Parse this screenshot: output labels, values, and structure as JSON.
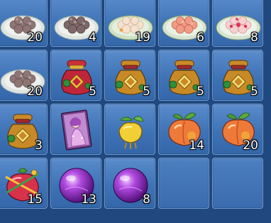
{
  "inventory": {
    "slots": [
      {
        "item": "plate-of-brown-rice-balls",
        "icon": "rice-ball-plate-icon",
        "count": "20"
      },
      {
        "item": "plate-of-dark-rice-balls",
        "icon": "rice-ball-plate-icon",
        "count": "4"
      },
      {
        "item": "plate-of-cream-rice-balls",
        "icon": "rice-ball-plate-icon",
        "count": "19"
      },
      {
        "item": "plate-of-pink-rice-balls",
        "icon": "rice-ball-plate-icon",
        "count": "6"
      },
      {
        "item": "plate-of-flower-rice-balls",
        "icon": "rice-ball-plate-icon",
        "count": "8"
      },
      {
        "item": "plate-of-brown-rice-balls",
        "icon": "rice-ball-plate-icon",
        "count": "20"
      },
      {
        "item": "red-lucky-bag",
        "icon": "red-lucky-bag-icon",
        "count": "5"
      },
      {
        "item": "gold-lucky-bag",
        "icon": "gold-lucky-bag-icon",
        "count": "5"
      },
      {
        "item": "gold-lucky-bag",
        "icon": "gold-lucky-bag-icon",
        "count": "5"
      },
      {
        "item": "gold-lucky-bag",
        "icon": "gold-lucky-bag-icon",
        "count": "5"
      },
      {
        "item": "gold-lucky-bag",
        "icon": "gold-lucky-bag-icon",
        "count": "3"
      },
      {
        "item": "character-card",
        "icon": "character-card-icon",
        "count": ""
      },
      {
        "item": "golden-fruit",
        "icon": "golden-fruit-icon",
        "count": ""
      },
      {
        "item": "peach",
        "icon": "peach-icon",
        "count": "14"
      },
      {
        "item": "peach",
        "icon": "peach-icon",
        "count": "20"
      },
      {
        "item": "ribboned-peach",
        "icon": "ribboned-peach-icon",
        "count": "15"
      },
      {
        "item": "purple-orb",
        "icon": "purple-orb-icon",
        "count": "13"
      },
      {
        "item": "purple-orb",
        "icon": "purple-orb-icon",
        "count": "8"
      },
      {
        "item": "",
        "icon": "",
        "count": ""
      },
      {
        "item": "",
        "icon": "",
        "count": ""
      }
    ]
  },
  "colors": {
    "background": "#21487f",
    "slot_top": "#5a8ccb",
    "slot_bottom": "#3467aa",
    "slot_border": "#6d9ccd",
    "count_text": "#ffffff"
  }
}
